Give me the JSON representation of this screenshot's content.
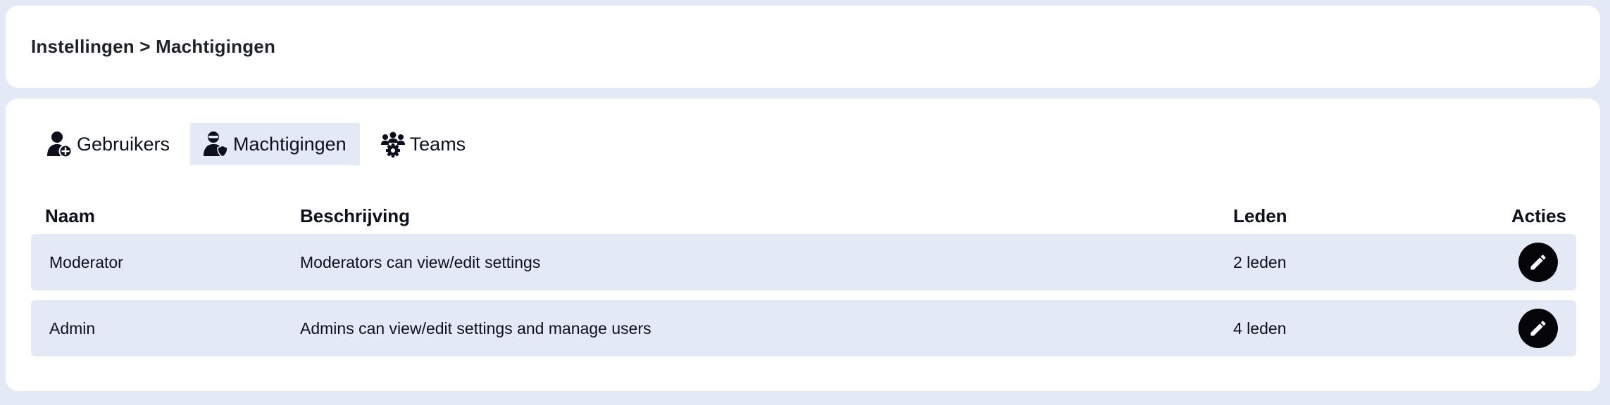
{
  "header": {
    "breadcrumb": "Instellingen > Machtigingen"
  },
  "tabs": [
    {
      "label": "Gebruikers",
      "icon": "user-add-icon",
      "active": false
    },
    {
      "label": "Machtigingen",
      "icon": "user-shield-icon",
      "active": true
    },
    {
      "label": "Teams",
      "icon": "team-gear-icon",
      "active": false
    }
  ],
  "table": {
    "columns": {
      "name": "Naam",
      "description": "Beschrijving",
      "members": "Leden",
      "actions": "Acties"
    },
    "rows": [
      {
        "name": "Moderator",
        "description": "Moderators can view/edit settings",
        "members": "2 leden",
        "action_icon": "pencil-icon"
      },
      {
        "name": "Admin",
        "description": "Admins can view/edit settings and manage users",
        "members": "4 leden",
        "action_icon": "pencil-icon"
      }
    ]
  },
  "colors": {
    "background": "#e4eaf5",
    "card": "#ffffff",
    "active_tab": "#e4eaf5",
    "row": "#e4eaf5",
    "action_button": "#050507",
    "text": "#0d0f1c"
  }
}
